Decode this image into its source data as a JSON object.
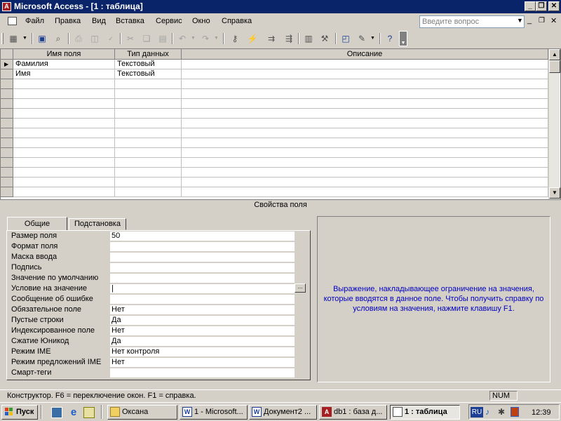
{
  "window": {
    "title": "Microsoft Access - [1 : таблица]",
    "icon": "access-icon",
    "title_color": "#0a246a"
  },
  "menu": {
    "items": [
      "Файл",
      "Правка",
      "Вид",
      "Вставка",
      "Сервис",
      "Окно",
      "Справка"
    ],
    "help_placeholder": "Введите вопрос"
  },
  "toolbar": {
    "icons": [
      "view-icon",
      "save-icon",
      "search-icon",
      "print-icon",
      "print-preview-icon",
      "spelling-icon",
      "cut-icon",
      "copy-icon",
      "paste-icon",
      "undo-icon",
      "redo-icon",
      "primary-key-icon",
      "indexes-icon",
      "insert-rows-icon",
      "delete-rows-icon",
      "properties-icon",
      "build-icon",
      "database-window-icon",
      "new-object-icon",
      "help-icon"
    ]
  },
  "grid": {
    "columns": [
      "Имя поля",
      "Тип данных",
      "Описание"
    ],
    "rows": [
      {
        "name": "Фамилия",
        "type": "Текстовый",
        "description": ""
      },
      {
        "name": "Имя",
        "type": "Текстовый",
        "description": ""
      }
    ]
  },
  "properties": {
    "title": "Свойства поля",
    "tabs": [
      "Общие",
      "Подстановка"
    ],
    "active_tab": "Общие",
    "fields": [
      {
        "label": "Размер поля",
        "value": "50"
      },
      {
        "label": "Формат поля",
        "value": ""
      },
      {
        "label": "Маска ввода",
        "value": ""
      },
      {
        "label": "Подпись",
        "value": ""
      },
      {
        "label": "Значение по умолчанию",
        "value": ""
      },
      {
        "label": "Условие на значение",
        "value": "|"
      },
      {
        "label": "Сообщение об ошибке",
        "value": ""
      },
      {
        "label": "Обязательное поле",
        "value": "Нет"
      },
      {
        "label": "Пустые строки",
        "value": "Да"
      },
      {
        "label": "Индексированное поле",
        "value": "Нет"
      },
      {
        "label": "Сжатие Юникод",
        "value": "Да"
      },
      {
        "label": "Режим IME",
        "value": "Нет контроля"
      },
      {
        "label": "Режим предложений IME",
        "value": "Нет"
      },
      {
        "label": "Смарт-теги",
        "value": ""
      }
    ],
    "builder_label": "...",
    "help_text": "Выражение, накладывающее ограничение на значения, которые вводятся в данное поле.  Чтобы получить справку по условиям на значения, нажмите клавишу F1.",
    "help_color": "#0000c0"
  },
  "status": {
    "text": "Конструктор.  F6 = переключение окон.  F1 = справка.",
    "num": "NUM"
  },
  "taskbar": {
    "start": "Пуск",
    "buttons": [
      {
        "label": "Оксана",
        "icon": "folder-icon"
      },
      {
        "label": "1 - Microsoft...",
        "icon": "word-icon"
      },
      {
        "label": "Документ2 ...",
        "icon": "word-icon"
      },
      {
        "label": "db1 : база д...",
        "icon": "access-icon"
      },
      {
        "label": "1 : таблица",
        "icon": "table-icon"
      }
    ],
    "lang": "RU",
    "clock": "12:39"
  }
}
